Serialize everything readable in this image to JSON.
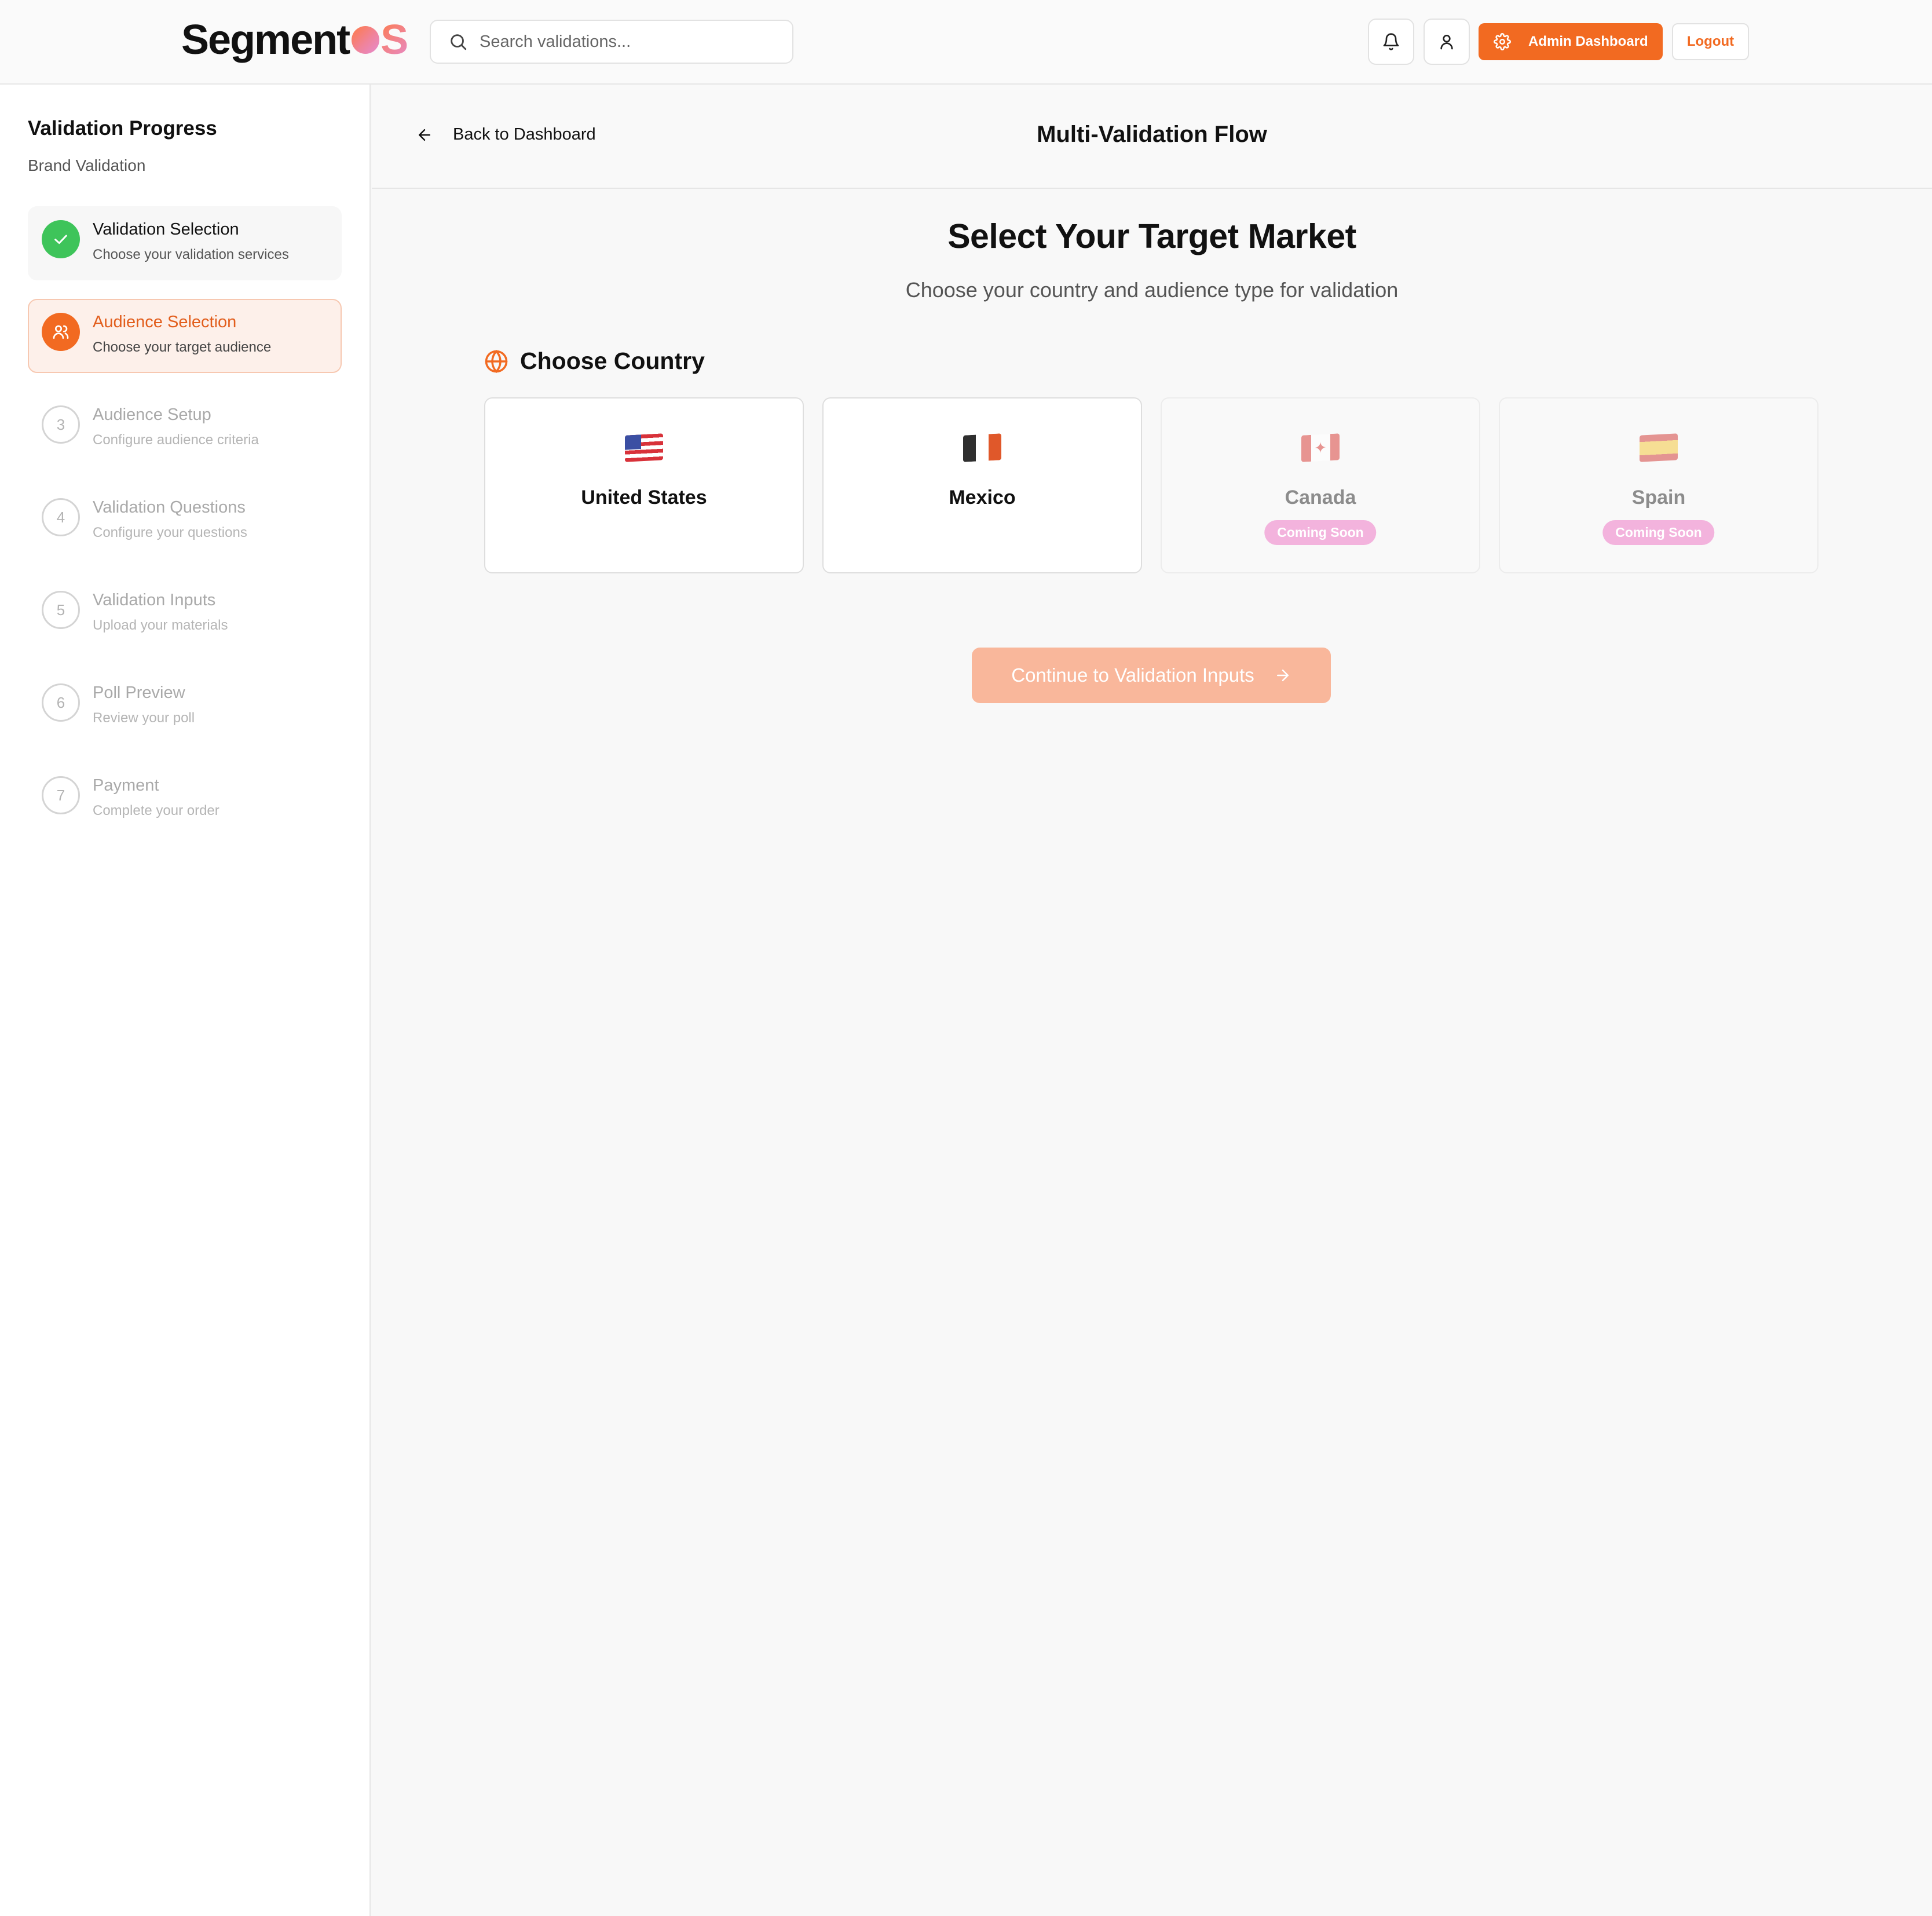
{
  "header": {
    "logo_text": "Segment",
    "logo_suffix": "S",
    "search_placeholder": "Search validations...",
    "admin_label": "Admin Dashboard",
    "logout_label": "Logout"
  },
  "sidebar": {
    "title": "Validation Progress",
    "subtitle": "Brand Validation",
    "steps": [
      {
        "number": "1",
        "title": "Validation Selection",
        "desc": "Choose your validation services",
        "state": "done"
      },
      {
        "number": "2",
        "title": "Audience Selection",
        "desc": "Choose your target audience",
        "state": "active"
      },
      {
        "number": "3",
        "title": "Audience Setup",
        "desc": "Configure audience criteria",
        "state": "pending"
      },
      {
        "number": "4",
        "title": "Validation Questions",
        "desc": "Configure your questions",
        "state": "pending"
      },
      {
        "number": "5",
        "title": "Validation Inputs",
        "desc": "Upload your materials",
        "state": "pending"
      },
      {
        "number": "6",
        "title": "Poll Preview",
        "desc": "Review your poll",
        "state": "pending"
      },
      {
        "number": "7",
        "title": "Payment",
        "desc": "Complete your order",
        "state": "pending"
      }
    ]
  },
  "subheader": {
    "back_label": "Back to Dashboard",
    "flow_title": "Multi-Validation Flow"
  },
  "main": {
    "title": "Select Your Target Market",
    "subtitle": "Choose your country and audience type for validation",
    "section_title": "Choose Country",
    "countries": [
      {
        "name": "United States",
        "flag": "us-flag",
        "available": true
      },
      {
        "name": "Mexico",
        "flag": "mexico-flag",
        "available": true
      },
      {
        "name": "Canada",
        "flag": "canada-flag",
        "available": false,
        "badge": "Coming Soon"
      },
      {
        "name": "Spain",
        "flag": "spain-flag",
        "available": false,
        "badge": "Coming Soon"
      }
    ],
    "cta_label": "Continue to Validation Inputs"
  },
  "colors": {
    "accent": "#f26a21",
    "success": "#3ec45a",
    "cta_disabled": "#f9b79b",
    "coming_soon": "#f3b3dd"
  }
}
